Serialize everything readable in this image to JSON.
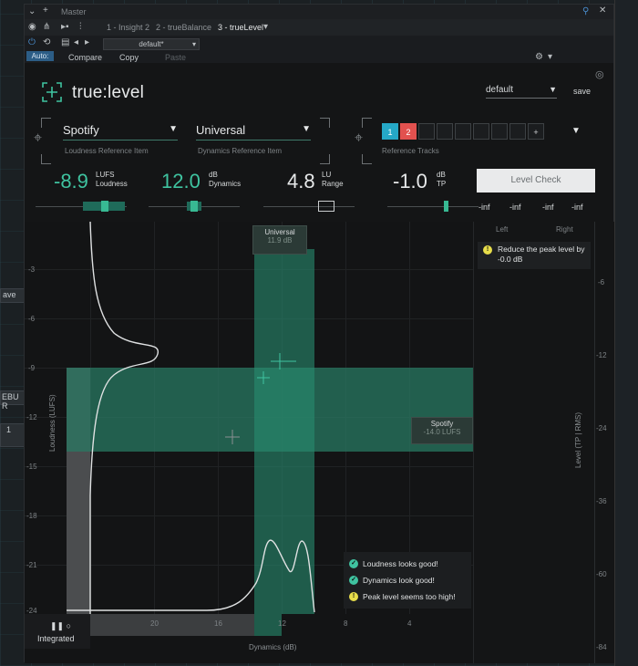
{
  "window": {
    "title": "Master",
    "tabs": [
      {
        "label": "1 - Insight 2",
        "active": false
      },
      {
        "label": "2 - trueBalance",
        "active": false
      },
      {
        "label": "3 - trueLevel",
        "active": true
      }
    ]
  },
  "toolbar": {
    "auto_off": "Auto: Off",
    "compare": "Compare",
    "copy": "Copy",
    "paste": "Paste",
    "preset": "default*"
  },
  "plugin": {
    "logo": "true:level",
    "preset_value": "default",
    "save_label": "save",
    "loudness_ref": {
      "value": "Spotify",
      "caption": "Loudness Reference Item"
    },
    "dynamics_ref": {
      "value": "Universal",
      "caption": "Dynamics Reference Item"
    },
    "reference_tracks": {
      "caption": "Reference Tracks",
      "slots": [
        "1",
        "2",
        "",
        "",
        "",
        "",
        "",
        "",
        "+"
      ]
    },
    "metrics": [
      {
        "value": "-8.9",
        "unit": "LUFS",
        "label": "Loudness",
        "color": "#3fc3a0"
      },
      {
        "value": "12.0",
        "unit": "dB",
        "label": "Dynamics",
        "color": "#3fc3a0"
      },
      {
        "value": "4.8",
        "unit": "LU",
        "label": "Range",
        "color": "#e6e8e9"
      },
      {
        "value": "-1.0",
        "unit": "dB",
        "label": "TP",
        "color": "#e6e8e9"
      }
    ],
    "level_check": "Level Check",
    "inf_values": [
      "-inf",
      "-inf",
      "-inf",
      "-inf"
    ]
  },
  "graph": {
    "y_label": "Loudness (LUFS)",
    "y_ticks": [
      "-3",
      "-6",
      "-9",
      "-12",
      "-15",
      "-18",
      "-21",
      "-24"
    ],
    "x_label": "Dynamics (dB)",
    "x_ticks": [
      "20",
      "16",
      "12",
      "8",
      "4"
    ],
    "universal_box": {
      "title": "Universal",
      "value": "11.9 dB"
    },
    "spotify_box": {
      "title": "Spotify",
      "value": "-14.0 LUFS"
    },
    "status": [
      {
        "type": "ok",
        "text": "Loudness looks good!"
      },
      {
        "type": "ok",
        "text": "Dynamics look good!"
      },
      {
        "type": "warn",
        "text": "Peak level seems too high!"
      }
    ],
    "mode": "Integrated"
  },
  "meter": {
    "left": "Left",
    "right": "Right",
    "message": "Reduce the peak level by -0.0 dB",
    "ticks": [
      "-6",
      "-12",
      "-24",
      "-36",
      "-60",
      "-84"
    ],
    "axis_label": "Level (TP | RMS)"
  },
  "host": {
    "left_labels": [
      "ave",
      "EBU R",
      "1"
    ]
  }
}
